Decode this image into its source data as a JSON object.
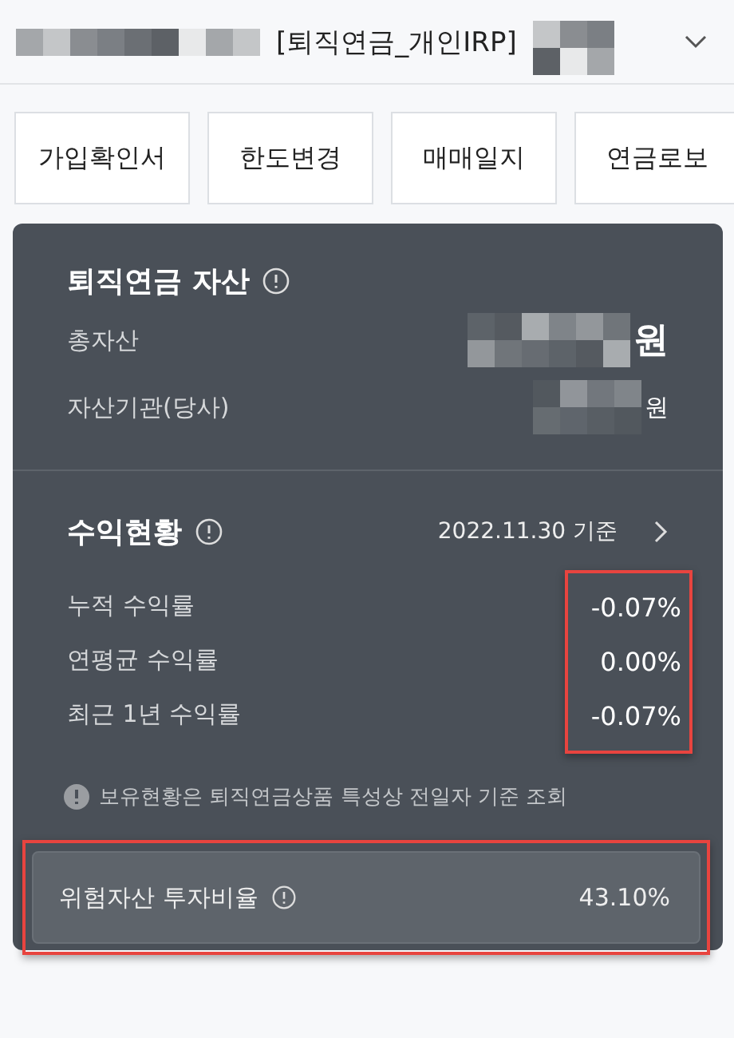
{
  "header": {
    "account_title": "[퇴직연금_개인IRP]"
  },
  "action_buttons": [
    "가입확인서",
    "한도변경",
    "매매일지",
    "연금로보"
  ],
  "assets": {
    "title": "퇴직연금 자산",
    "rows": [
      {
        "kind": "bold",
        "label": "총자산",
        "unit": "원"
      },
      {
        "kind": "plain",
        "label": "자산기관(당사)",
        "unit": "원"
      }
    ]
  },
  "returns": {
    "title": "수익현황",
    "as_of": "2022.11.30 기준",
    "highlighted": true,
    "rows": [
      {
        "label": "누적 수익률",
        "value": "-0.07%"
      },
      {
        "label": "연평균 수익률",
        "value": "0.00%"
      },
      {
        "label": "최근 1년 수익률",
        "value": "-0.07%"
      }
    ]
  },
  "notice": "보유현황은 퇴직연금상품 특성상 전일자 기준 조회",
  "risk": {
    "label": "위험자산 투자비율",
    "value": "43.10%",
    "highlighted": true
  }
}
